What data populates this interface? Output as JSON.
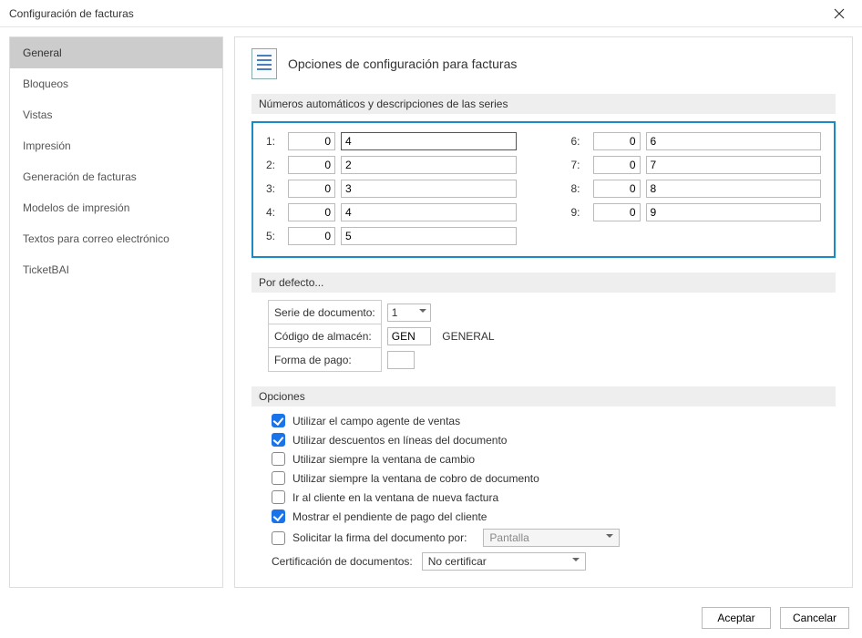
{
  "window": {
    "title": "Configuración de facturas"
  },
  "sidebar": {
    "items": [
      {
        "label": "General",
        "selected": true
      },
      {
        "label": "Bloqueos",
        "selected": false
      },
      {
        "label": "Vistas",
        "selected": false
      },
      {
        "label": "Impresión",
        "selected": false
      },
      {
        "label": "Generación de facturas",
        "selected": false
      },
      {
        "label": "Modelos de impresión",
        "selected": false
      },
      {
        "label": "Textos para correo electrónico",
        "selected": false
      },
      {
        "label": "TicketBAI",
        "selected": false
      }
    ]
  },
  "header": {
    "title": "Opciones de configuración para facturas"
  },
  "section_series": {
    "title": "Números automáticos y descripciones de las series"
  },
  "series": [
    {
      "idx": "1:",
      "num": "0",
      "desc": "4"
    },
    {
      "idx": "2:",
      "num": "0",
      "desc": "2"
    },
    {
      "idx": "3:",
      "num": "0",
      "desc": "3"
    },
    {
      "idx": "4:",
      "num": "0",
      "desc": "4"
    },
    {
      "idx": "5:",
      "num": "0",
      "desc": "5"
    },
    {
      "idx": "6:",
      "num": "0",
      "desc": "6"
    },
    {
      "idx": "7:",
      "num": "0",
      "desc": "7"
    },
    {
      "idx": "8:",
      "num": "0",
      "desc": "8"
    },
    {
      "idx": "9:",
      "num": "0",
      "desc": "9"
    }
  ],
  "section_defaults": {
    "title": "Por defecto..."
  },
  "defaults": {
    "serie_label": "Serie de documento:",
    "serie_value": "1",
    "almacen_label": "Código de almacén:",
    "almacen_code": "GEN",
    "almacen_name": "GENERAL",
    "pago_label": "Forma de pago:",
    "pago_value": ""
  },
  "section_options": {
    "title": "Opciones"
  },
  "options": [
    {
      "label": "Utilizar el campo agente de ventas",
      "checked": true
    },
    {
      "label": "Utilizar descuentos en líneas del documento",
      "checked": true
    },
    {
      "label": "Utilizar siempre la ventana de cambio",
      "checked": false
    },
    {
      "label": "Utilizar siempre la ventana de cobro de documento",
      "checked": false
    },
    {
      "label": "Ir al cliente en la ventana de nueva factura",
      "checked": false
    },
    {
      "label": "Mostrar el pendiente de pago del cliente",
      "checked": true
    },
    {
      "label": "Solicitar la firma del documento por:",
      "checked": false
    }
  ],
  "firma_select": "Pantalla",
  "cert": {
    "label": "Certificación de documentos:",
    "value": "No certificar"
  },
  "footer": {
    "accept": "Aceptar",
    "cancel": "Cancelar"
  }
}
